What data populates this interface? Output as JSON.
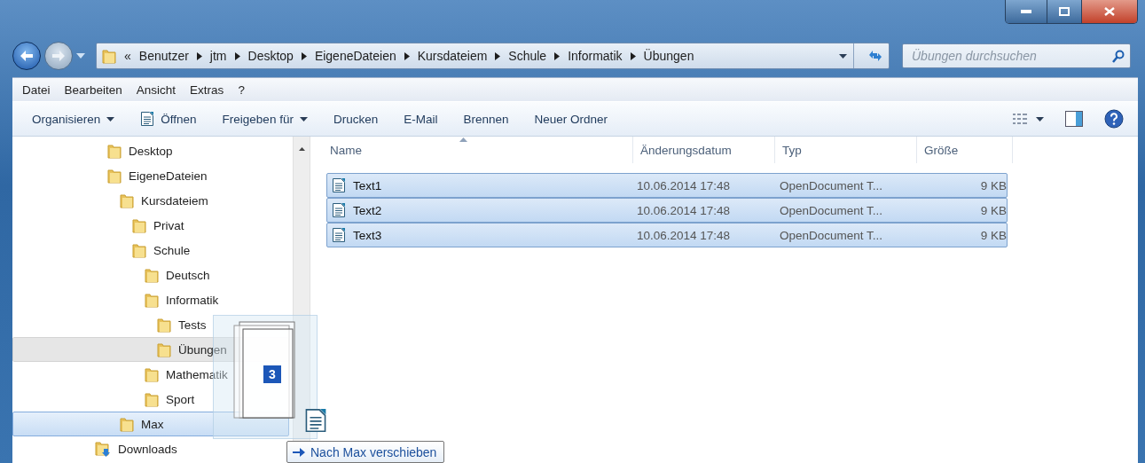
{
  "address": {
    "overflow": "«",
    "crumbs": [
      "Benutzer",
      "jtm",
      "Desktop",
      "EigeneDateien",
      "Kursdateiem",
      "Schule",
      "Informatik",
      "Übungen"
    ]
  },
  "search": {
    "placeholder": "Übungen durchsuchen"
  },
  "menu": [
    "Datei",
    "Bearbeiten",
    "Ansicht",
    "Extras",
    "?"
  ],
  "toolbar": [
    {
      "label": "Organisieren",
      "kind": "menu"
    },
    {
      "label": "Öffnen",
      "kind": "icon"
    },
    {
      "label": "Freigeben für",
      "kind": "menu"
    },
    {
      "label": "Drucken",
      "kind": "plain"
    },
    {
      "label": "E-Mail",
      "kind": "plain"
    },
    {
      "label": "Brennen",
      "kind": "plain"
    },
    {
      "label": "Neuer Ordner",
      "kind": "plain"
    }
  ],
  "tree": {
    "continued": [
      {
        "label": "Desktop",
        "selected": false,
        "drop_target": false
      },
      {
        "label": "EigeneDateien",
        "selected": false,
        "drop_target": false,
        "children": [
          {
            "label": "Kursdateiem",
            "selected": false,
            "drop_target": false,
            "children": [
              {
                "label": "Privat",
                "selected": false,
                "drop_target": false
              },
              {
                "label": "Schule",
                "selected": false,
                "drop_target": false,
                "children": [
                  {
                    "label": "Deutsch",
                    "selected": false,
                    "drop_target": false
                  },
                  {
                    "label": "Informatik",
                    "selected": false,
                    "drop_target": false,
                    "children": [
                      {
                        "label": "Tests",
                        "selected": false,
                        "drop_target": false
                      },
                      {
                        "label": "Übungen",
                        "selected": true,
                        "drop_target": false
                      }
                    ]
                  },
                  {
                    "label": "Mathematik",
                    "selected": false,
                    "drop_target": false
                  },
                  {
                    "label": "Sport",
                    "selected": false,
                    "drop_target": false
                  }
                ]
              }
            ]
          },
          {
            "label": "Max",
            "selected": false,
            "drop_target": true
          }
        ]
      }
    ],
    "items": [
      {
        "label": "Downloads",
        "selected": false,
        "drop_target": false,
        "kind": "download"
      }
    ]
  },
  "table": {
    "columns": [
      {
        "label": "Name",
        "sorted": true
      },
      {
        "label": "Änderungsdatum",
        "sorted": false
      },
      {
        "label": "Typ",
        "sorted": false
      },
      {
        "label": "Größe",
        "sorted": false
      }
    ],
    "rows": [
      {
        "name": "Text1",
        "date": "10.06.2014 17:48",
        "type": "OpenDocument T...",
        "size": "9 KB",
        "selected": true
      },
      {
        "name": "Text2",
        "date": "10.06.2014 17:48",
        "type": "OpenDocument T...",
        "size": "9 KB",
        "selected": true
      },
      {
        "name": "Text3",
        "date": "10.06.2014 17:48",
        "type": "OpenDocument T...",
        "size": "9 KB",
        "selected": true
      }
    ]
  },
  "drag": {
    "count": "3",
    "tooltip": "Nach Max verschieben"
  }
}
